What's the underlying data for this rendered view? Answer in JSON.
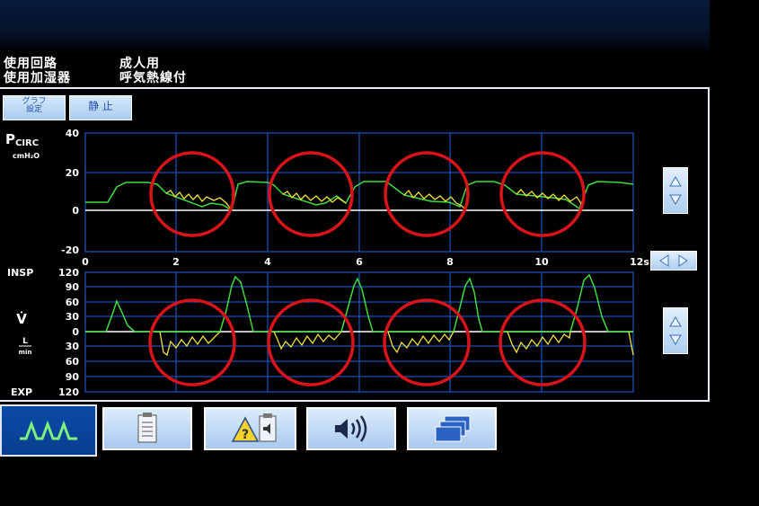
{
  "info": {
    "circuit_label": "使用回路",
    "circuit_value": "成人用",
    "humidifier_label": "使用加湿器",
    "humidifier_value": "呼気熱線付"
  },
  "toolbar": {
    "graph_settings_line1": "グラフ",
    "graph_settings_line2": "設定",
    "freeze_label": "静 止"
  },
  "pressure_graph": {
    "label_main": "P",
    "label_sub": "CIRC",
    "unit": "cmH₂O",
    "y_ticks": [
      "40",
      "20",
      "0",
      "-20"
    ],
    "x_ticks": [
      "0",
      "2",
      "4",
      "6",
      "8",
      "10",
      "12s"
    ]
  },
  "flow_graph": {
    "label_insp": "INSP",
    "label_exp": "EXP",
    "label_symbol": "V̇",
    "unit_num": "L",
    "unit_den": "min",
    "y_ticks": [
      "120",
      "90",
      "60",
      "30",
      "0",
      "30",
      "60",
      "90",
      "120"
    ]
  },
  "colors": {
    "grid": "#1a4fb5",
    "baseline": "#ffffff",
    "insp_trace": "#3fdc3f",
    "exp_trace": "#f2e13a",
    "highlight": "#d8141a",
    "button": "#b8d6f4"
  },
  "tabs": [
    {
      "icon": "waveform-icon",
      "active": true
    },
    {
      "icon": "clipboard-icon",
      "active": false
    },
    {
      "icon": "alarm-warning-icon",
      "active": false
    },
    {
      "icon": "speaker-volume-icon",
      "active": false
    },
    {
      "icon": "windows-stack-icon",
      "active": false
    }
  ]
}
